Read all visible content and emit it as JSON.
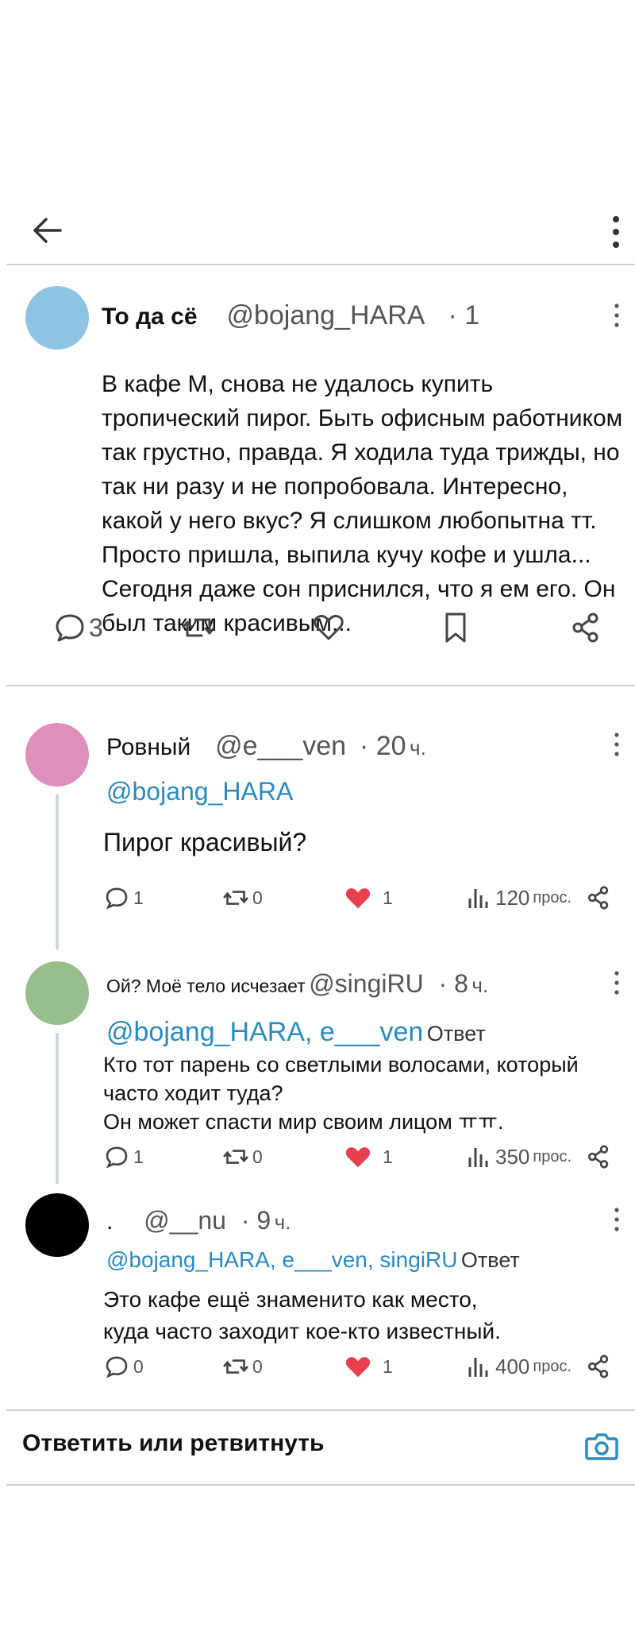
{
  "header": {
    "back_icon": "arrow-left-icon",
    "more_icon": "more-vertical-icon"
  },
  "post": {
    "avatar_color": "#8ec3e2",
    "name": "То да  сё",
    "handle": "@bojang_HARA",
    "time": "· 1",
    "text": "В кафе М, снова не удалось купить тропический пирог. Быть офисным работником так грустно, правда. Я ходила туда трижды, но так ни разу и не попробовала. Интересно, какой у него вкус? Я слишком любопытна тт. Просто пришла, выпила кучу кофе и ушла... Сегодня даже сон приснился, что я ем его. Он был таким красивым...",
    "reply_count": "3",
    "icons": [
      "comment-icon",
      "retweet-icon",
      "heart-icon",
      "bookmark-icon",
      "share-icon"
    ]
  },
  "replies": [
    {
      "avatar_color": "#e08fbd",
      "name": "Ровный",
      "handle": "@e___ven",
      "time_num": "· 20",
      "time_unit": "ч.",
      "mentions": "@bojang_HARA",
      "reply_word": "",
      "text": "Пирог красивый?",
      "comments": "1",
      "retweets": "0",
      "likes": "1",
      "views": "120",
      "views_label": "прос."
    },
    {
      "avatar_color": "#97bd8a",
      "name": "Ой? Моё тело исчезает",
      "handle": "@singiRU",
      "time_num": "· 8",
      "time_unit": "ч.",
      "mentions": "@bojang_HARA, e___ven",
      "reply_word": "Ответ",
      "text_line1": "Кто тот парень со светлыми волосами, который",
      "text_line2": "часто ходит туда?",
      "text_line3": "Он может спасти мир своим лицом ㅠㅠ.",
      "comments": "1",
      "retweets": "0",
      "likes": "1",
      "views": "350",
      "views_label": "прос."
    },
    {
      "avatar_color": "#000000",
      "name": ".",
      "handle": "@__nu",
      "time_num": "· 9",
      "time_unit": "ч.",
      "mentions": "@bojang_HARA, e___ven, singiRU",
      "reply_word": "Ответ",
      "text_line1": "Это кафе ещё знаменито как место,",
      "text_line2": "куда часто заходит кое-кто известный.",
      "comments": "0",
      "retweets": "0",
      "likes": "1",
      "views": "400",
      "views_label": "прос."
    }
  ],
  "compose": {
    "label": "Ответить или ретвитнуть",
    "camera_icon": "camera-icon"
  },
  "colors": {
    "like_red": "#e8404f",
    "mention_blue": "#2a8bc0",
    "camera_blue": "#2a8bc0"
  }
}
